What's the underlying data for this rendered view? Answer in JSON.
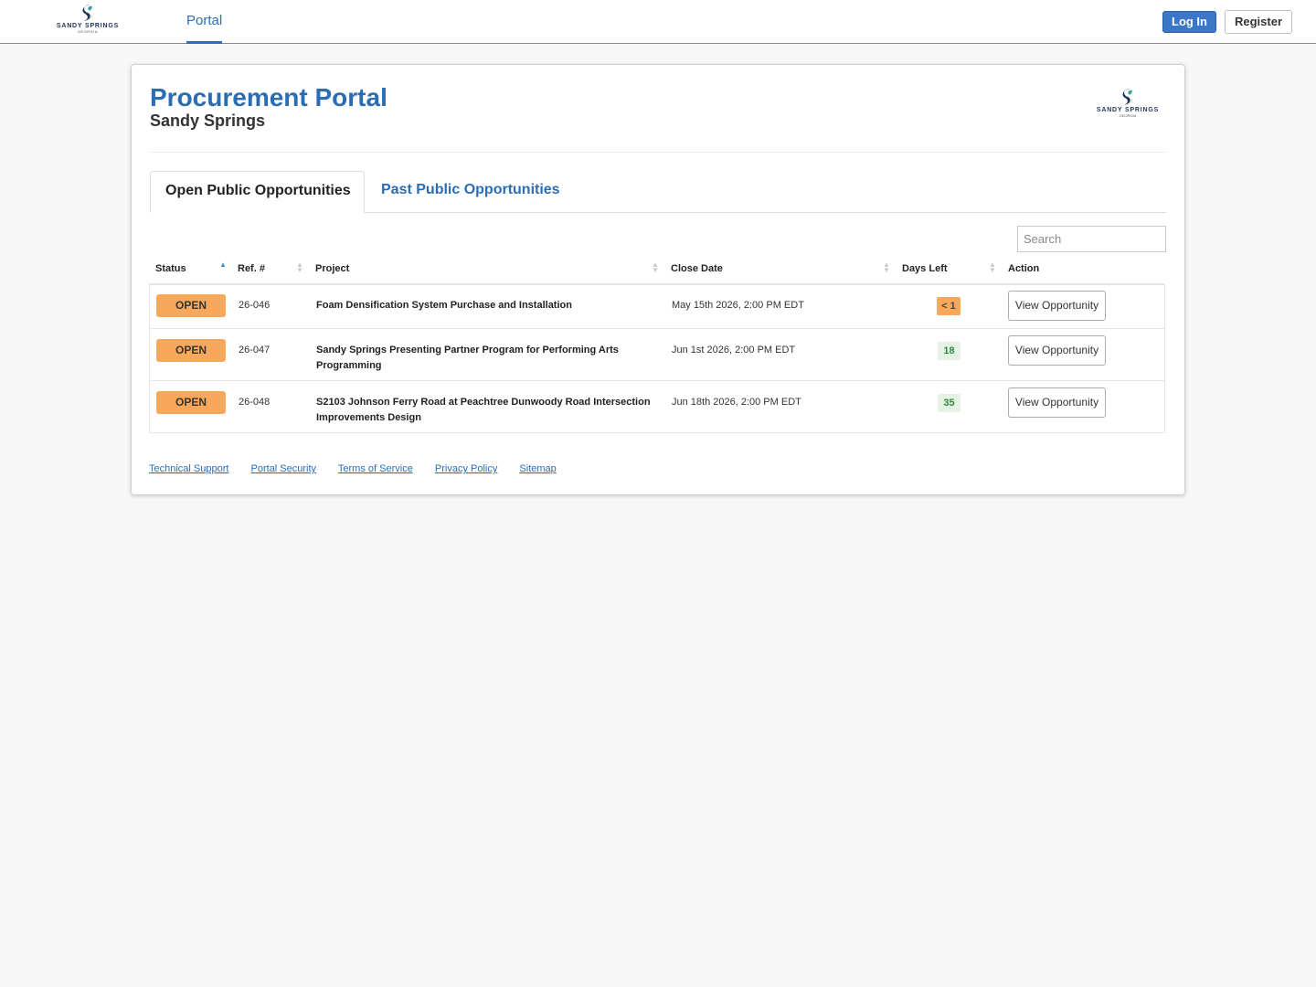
{
  "header": {
    "brand_wordmark": "SANDY SPRINGS",
    "brand_sub": "GEORGIA",
    "nav_portal": "Portal",
    "login_label": "Log In",
    "register_label": "Register"
  },
  "card": {
    "title": "Procurement Portal",
    "subtitle": "Sandy Springs",
    "logo_wordmark": "SANDY SPRINGS",
    "logo_sub": "GEORGIA"
  },
  "tabs": {
    "open_label": "Open Public Opportunities",
    "past_label": "Past Public Opportunities"
  },
  "search": {
    "placeholder": "Search"
  },
  "table": {
    "headers": {
      "status": "Status",
      "ref": "Ref. #",
      "project": "Project",
      "close_date": "Close Date",
      "days_left": "Days Left",
      "action": "Action"
    },
    "rows": [
      {
        "status": "OPEN",
        "ref": "26-046",
        "project": "Foam Densification System Purchase and Installation",
        "close_date": "May 15th 2026, 2:00 PM EDT",
        "days_left": "< 1",
        "action": "View Opportunity"
      },
      {
        "status": "OPEN",
        "ref": "26-047",
        "project": "Sandy Springs Presenting Partner Program for Performing Arts Programming",
        "close_date": "Jun 1st 2026, 2:00 PM EDT",
        "days_left": "18",
        "action": "View Opportunity"
      },
      {
        "status": "OPEN",
        "ref": "26-048",
        "project": "S2103 Johnson Ferry Road at Peachtree Dunwoody Road Intersection Improvements Design",
        "close_date": "Jun 18th 2026, 2:00 PM EDT",
        "days_left": "35",
        "action": "View Opportunity"
      }
    ]
  },
  "footer": {
    "links": [
      "Technical Support",
      "Portal Security",
      "Terms of Service",
      "Privacy Policy",
      "Sitemap"
    ]
  },
  "colors": {
    "accent": "#2a6db5",
    "open_badge": "#f7a85a",
    "days_ok_bg": "#e5f2e5",
    "days_ok_text": "#2e8b3e"
  }
}
